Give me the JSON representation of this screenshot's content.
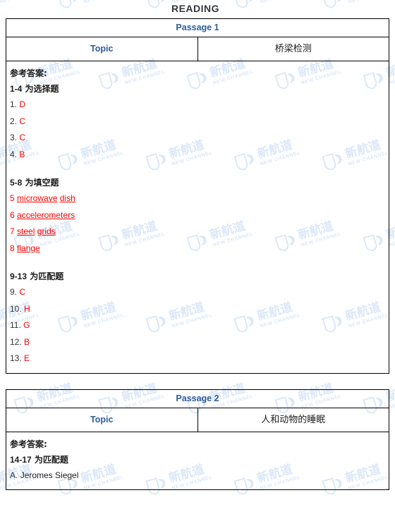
{
  "page": {
    "title": "READING"
  },
  "watermark": {
    "chinese": "新航道",
    "english": "NEW CHANNEL",
    "logo_letters": "NC",
    "color": "#dbe8f8"
  },
  "colors": {
    "heading_blue": "#2e5c9a",
    "answer_red": "#ff0000",
    "text_dark": "#1c1c1c",
    "border": "#000000"
  },
  "passages": [
    {
      "header": "Passage 1",
      "topic_label": "Topic",
      "topic_value": "桥梁检测",
      "answers_title": "参考答案:",
      "groups": [
        {
          "range": "1-4",
          "type_label": "为选择题",
          "style": "plain-number",
          "items": [
            {
              "num": "1.",
              "answer": "D"
            },
            {
              "num": "2.",
              "answer": "C"
            },
            {
              "num": "3.",
              "answer": "C"
            },
            {
              "num": "4.",
              "answer": "B"
            }
          ]
        },
        {
          "range": "5-8",
          "type_label": "为填空题",
          "style": "red-underline",
          "items": [
            {
              "num": "5",
              "answer": "microwave dish"
            },
            {
              "num": "6",
              "answer": "accelerometers"
            },
            {
              "num": "7",
              "answer": "steel grids"
            },
            {
              "num": "8",
              "answer": "flange"
            }
          ]
        },
        {
          "range": "9-13",
          "type_label": "为匹配题",
          "style": "plain-number",
          "items": [
            {
              "num": "9.",
              "answer": "C"
            },
            {
              "num": "10.",
              "answer": "H"
            },
            {
              "num": "11.",
              "answer": "G"
            },
            {
              "num": "12.",
              "answer": "B"
            },
            {
              "num": "13.",
              "answer": "E"
            }
          ]
        }
      ]
    },
    {
      "header": "Passage 2",
      "topic_label": "Topic",
      "topic_value": "人和动物的睡眠",
      "answers_title": "参考答案:",
      "groups": [
        {
          "range": "14-17",
          "type_label": "为匹配题",
          "style": "black-text",
          "items": [
            {
              "num": "A.",
              "answer": "Jeromes Siegel"
            }
          ]
        }
      ]
    }
  ]
}
